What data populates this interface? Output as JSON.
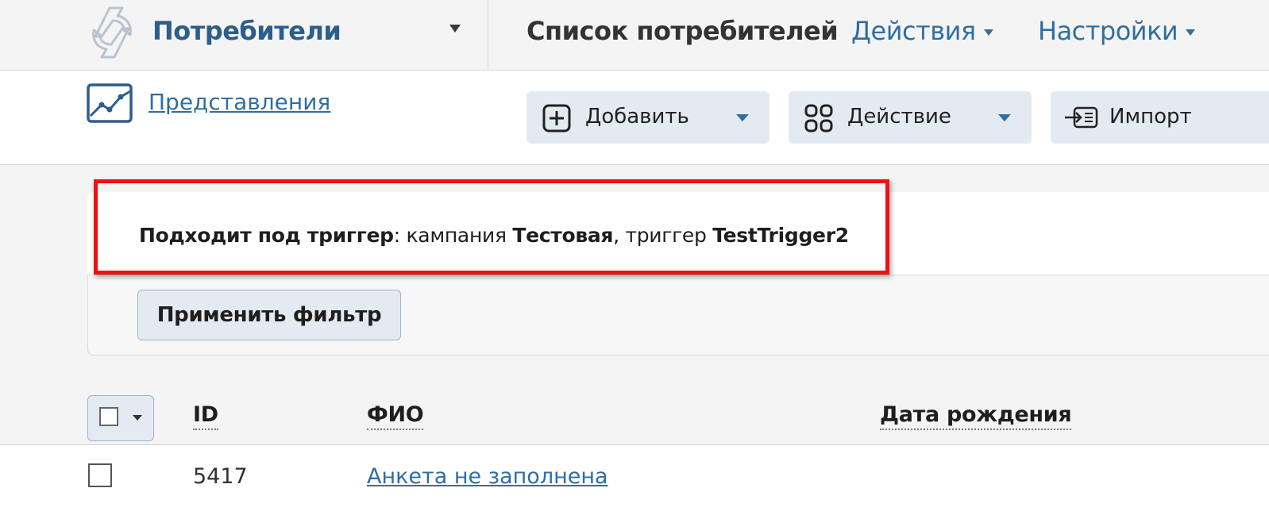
{
  "header": {
    "section_title": "Потребители",
    "page_title": "Список потребителей",
    "menus": [
      {
        "label": "Действия"
      },
      {
        "label": "Настройки"
      }
    ]
  },
  "toolbar": {
    "views_link": "Представления",
    "buttons": [
      {
        "label": "Добавить",
        "icon": "plus-square-icon"
      },
      {
        "label": "Действие",
        "icon": "grid-icon"
      },
      {
        "label": "Импорт",
        "icon": "import-icon"
      }
    ]
  },
  "filter": {
    "label": "Подходит под триггер",
    "separator": ": ",
    "campaign_prefix": "кампания ",
    "campaign_name": "Тестовая",
    "trigger_prefix": ", триггер ",
    "trigger_name": "TestTrigger2",
    "apply_button": "Применить фильтр",
    "highlight_color": "#ee1111"
  },
  "table": {
    "columns": [
      "ID",
      "ФИО",
      "Дата рождения"
    ],
    "rows": [
      {
        "id": "5417",
        "name": "Анкета не заполнена",
        "birth_date": ""
      }
    ]
  },
  "colors": {
    "brand": "#2d5d8a",
    "link": "#2f6ea3",
    "button_bg": "#e3eaf1"
  }
}
